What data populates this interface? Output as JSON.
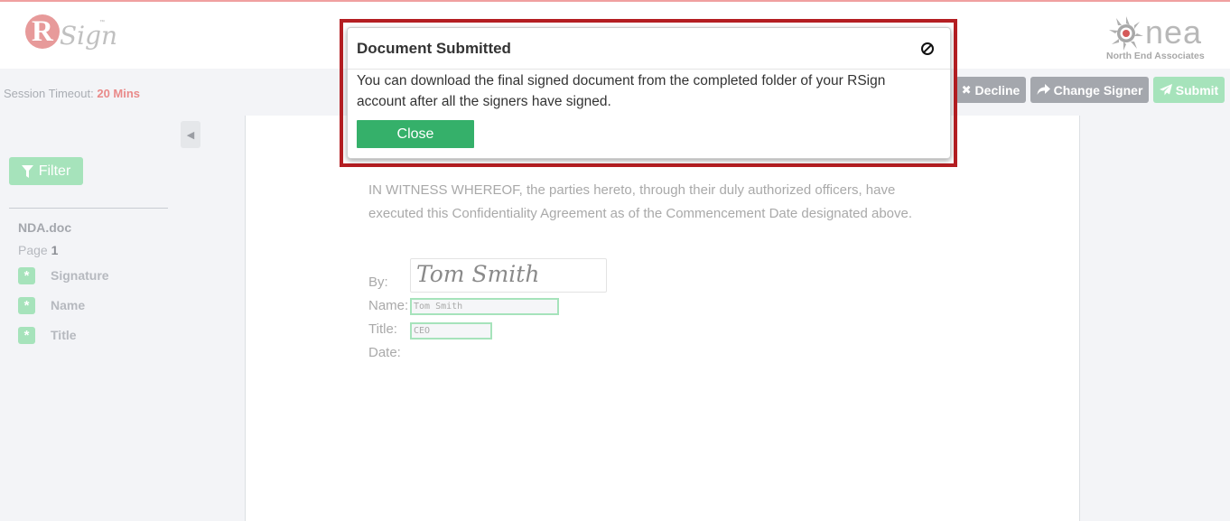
{
  "header": {
    "brand_r": "R",
    "brand_sign": "Sign",
    "brand_tm": "™",
    "partner_logo_text": "nea",
    "partner_logo_sub": "North End Associates"
  },
  "subbar": {
    "session_label": "Session Timeout:",
    "session_value": "20 Mins",
    "buttons": [
      {
        "label": "Decline",
        "icon": "close-icon"
      },
      {
        "label": "Change Signer",
        "icon": "share-arrow-icon"
      },
      {
        "label": "Submit",
        "icon": "paper-plane-icon"
      }
    ]
  },
  "sidebar": {
    "filter_label": "Filter",
    "doc_name": "NDA.doc",
    "page_label": "Page",
    "page_number": "1",
    "fields": [
      {
        "badge": "*",
        "label": "Signature"
      },
      {
        "badge": "*",
        "label": "Name"
      },
      {
        "badge": "*",
        "label": "Title"
      }
    ]
  },
  "document": {
    "witness_text": "IN WITNESS WHEREOF, the parties hereto, through their duly authorized officers, have executed this Confidentiality Agreement as of the Commencement Date designated above.",
    "by_label": "By:",
    "name_label": "Name:",
    "title_label": "Title:",
    "date_label": "Date:",
    "signature_value": "Tom Smith",
    "name_value": "Tom Smith",
    "title_value": "CEO"
  },
  "modal": {
    "title": "Document Submitted",
    "body": "You can download the final signed document from the completed folder of your RSign account after all the signers have signed.",
    "close_label": "Close"
  },
  "colors": {
    "accent_green": "#35b06a",
    "highlight_red": "#b41e22",
    "brand_pink": "#e79a9a"
  }
}
